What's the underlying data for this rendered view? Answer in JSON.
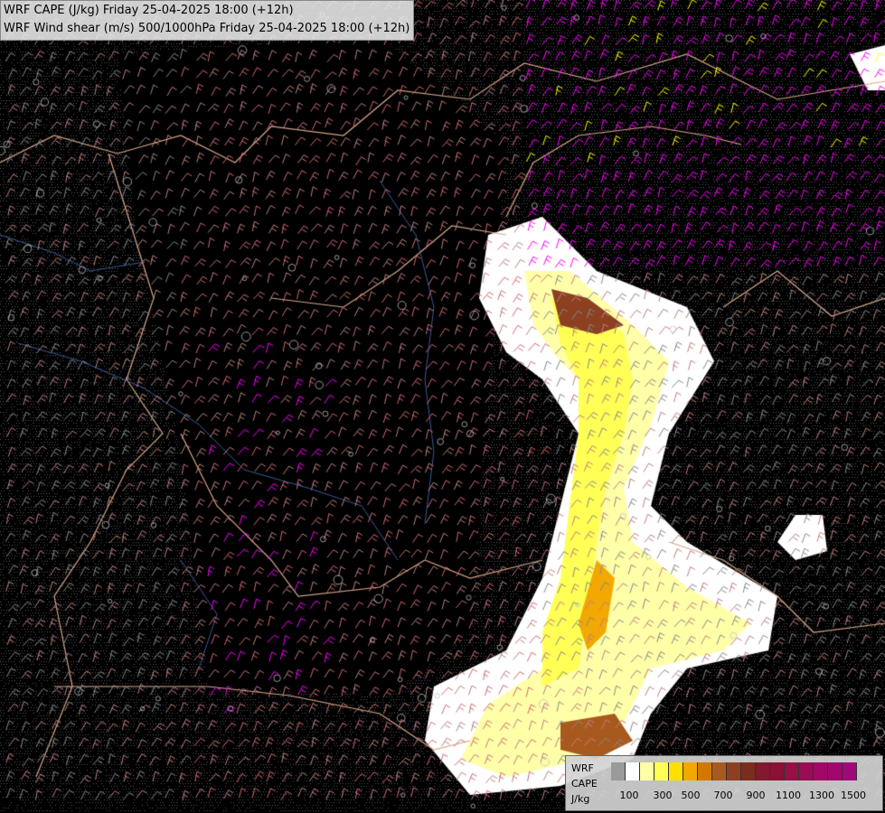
{
  "header": {
    "line1": "WRF CAPE (J/kg) Friday 25-04-2025 18:00 (+12h)",
    "line2": "WRF Wind shear (m/s) 500/1000hPa Friday 25-04-2025 18:00 (+12h)"
  },
  "legend": {
    "labels": [
      "WRF",
      "CAPE",
      "J/kg"
    ],
    "colors": [
      "#9a9a9a",
      "#ffffff",
      "#ffffa8",
      "#ffff55",
      "#ffe000",
      "#f2a800",
      "#d27800",
      "#a85a1e",
      "#8c4020",
      "#7a2d1e",
      "#801a2d",
      "#8a1035",
      "#941045",
      "#9a0c55",
      "#a00a66",
      "#a0086e",
      "#a0087a"
    ],
    "ticks": [
      "100",
      "300",
      "500",
      "700",
      "900",
      "1100",
      "1300",
      "1500"
    ]
  },
  "map": {
    "background": "#000000",
    "shear_colors": {
      "low": "#888888",
      "moderate": "#c08080",
      "high": "#d06a74",
      "very_high": "#ff00ff",
      "extreme": "#ffff00"
    },
    "border_color": "#d8a888",
    "river_color": "#3a5a9a",
    "contour_color": "#c0c0c0"
  }
}
